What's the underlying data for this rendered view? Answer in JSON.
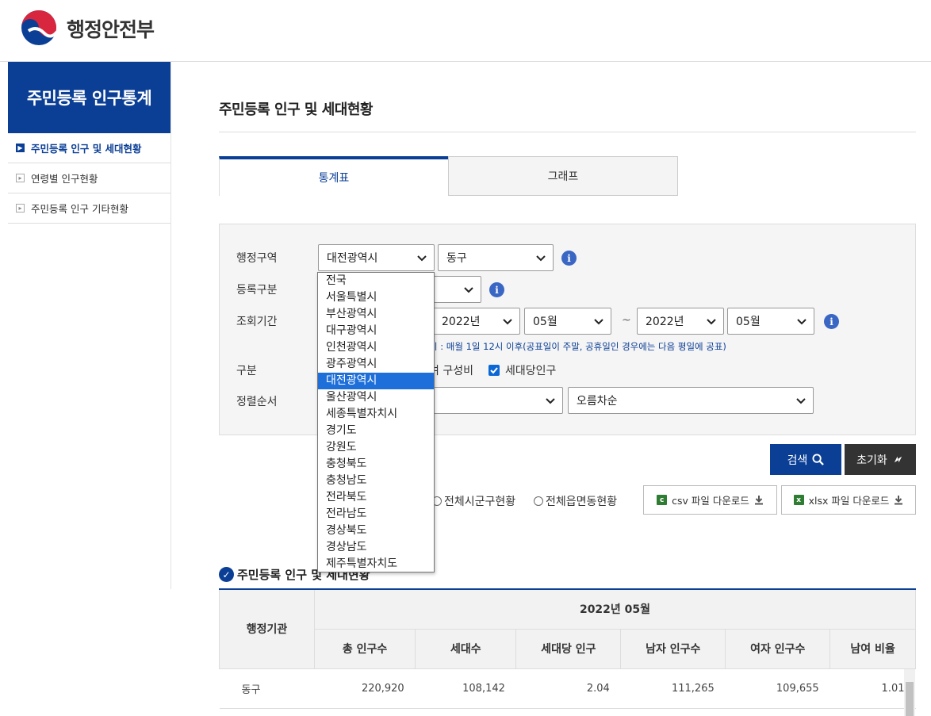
{
  "header": {
    "logo_text": "행정안전부"
  },
  "sidebar": {
    "title": "주민등록 인구통계",
    "items": [
      {
        "label": "주민등록 인구 및 세대현황",
        "active": true
      },
      {
        "label": "연령별 인구현황",
        "active": false
      },
      {
        "label": "주민등록 인구 기타현황",
        "active": false
      }
    ]
  },
  "main": {
    "page_title": "주민등록 인구 및 세대현황",
    "tabs": [
      {
        "label": "통계표",
        "active": true
      },
      {
        "label": "그래프",
        "active": false
      }
    ]
  },
  "search": {
    "labels": {
      "region": "행정구역",
      "registration": "등록구분",
      "period": "조회기간",
      "category": "구분",
      "sort": "정렬순서"
    },
    "region_sido": "대전광역시",
    "region_sigungu": "동구",
    "period_from_year": "2022년",
    "period_from_month": "05월",
    "tilde": "~",
    "period_to_year": "2022년",
    "period_to_month": "05월",
    "period_note": "시 : 매월 1일 12시 이후(공표일이 주말, 공휴일인 경우에는 다음 평일에 공표)",
    "category_partial": "며 구성비",
    "category_per_household": "세대당인구",
    "sort_order": "오름차순"
  },
  "buttons": {
    "search": "검색",
    "reset": "초기화"
  },
  "options": {
    "all_sigungu": "전체시군구현황",
    "all_eupmyeondong": "전체읍면동현황"
  },
  "downloads": {
    "csv": "csv 파일 다운로드",
    "xlsx": "xlsx 파일 다운로드"
  },
  "section_title": "주민등록 인구 및 세대현황",
  "table": {
    "header_org": "행정기관",
    "header_period": "2022년 05월",
    "columns": [
      "총 인구수",
      "세대수",
      "세대당 인구",
      "남자 인구수",
      "여자 인구수",
      "남여 비율"
    ],
    "rows": [
      {
        "name": "동구",
        "values": [
          "220,920",
          "108,142",
          "2.04",
          "111,265",
          "109,655",
          "1.01"
        ]
      }
    ]
  },
  "dropdown": {
    "options": [
      "전국",
      "서울특별시",
      "부산광역시",
      "대구광역시",
      "인천광역시",
      "광주광역시",
      "대전광역시",
      "울산광역시",
      "세종특별자치시",
      "경기도",
      "강원도",
      "충청북도",
      "충청남도",
      "전라북도",
      "전라남도",
      "경상북도",
      "경상남도",
      "제주특별자치도"
    ],
    "selected": "대전광역시"
  },
  "colors": {
    "brand": "#0b3f96",
    "highlight": "#1e6fd9"
  }
}
